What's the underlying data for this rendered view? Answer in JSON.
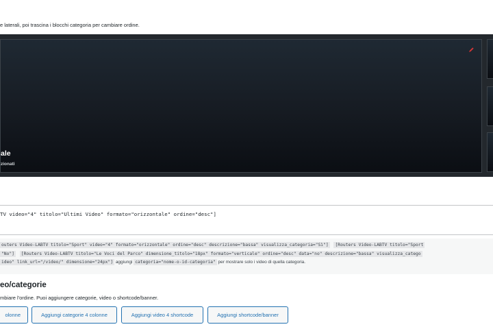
{
  "intro_hint": "e laterali, poi trascina i blocchi categoria per cambiare ordine.",
  "hero": {
    "title": "ale",
    "subtitle": "zionati",
    "edit_icon": "pencil-icon"
  },
  "shortcode_field": {
    "value": "TV video=\"4\" titolo=\"Ultimi Video\" formato=\"orizzontale\" ordine=\"desc\"]"
  },
  "help": {
    "line1": {
      "code1": "outers Video-LABTV titolo=\"Sport\" video=\"4\" formato=\"orizzontale\" ordine=\"desc\" descrizione=\"bassa\" visualizza_categoria=\"Sì\"]",
      "code2": "[Routers Video-LABTV titolo=\"Sport"
    },
    "line2": {
      "code1": "\"No\"]",
      "code2": "[Routers Video-LABTV titolo=\"Le Voci del Parco\" dimensione_titolo=\"18px\" formato=\"verticale\" ordine=\"desc\" data=\"no\" descrizione=\"bassa\" visualizza_catego"
    },
    "line3": {
      "code1": "ideo\" link_url=\"/video/\" dimensione=\"24px\"]",
      "text1": " aggiungi ",
      "code2": "categoria=\"nome-o-id-categoria\"",
      "text2": " per mostrare solo i video di quella categoria."
    }
  },
  "section": {
    "title": "eo/categorie",
    "description": "mbiare l'ordine. Puoi aggiungere categorie, video o shortcode/banner."
  },
  "buttons": {
    "partial": "olonne",
    "add_categories": "Aggiungi categorie 4 colonne",
    "add_videos": "Aggiungi video 4 shortcode",
    "add_shortcode": "Aggiungi shortcode/banner"
  },
  "colors": {
    "accent": "#2271b1",
    "edit_icon": "#d63638",
    "panel_bg": "#23282d"
  }
}
